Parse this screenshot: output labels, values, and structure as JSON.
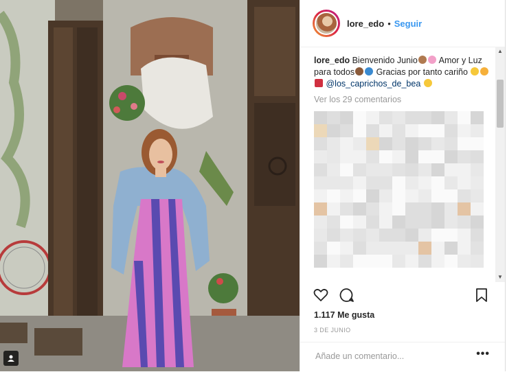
{
  "post": {
    "username": "lore_edo",
    "separator": "•",
    "follow_label": "Seguir"
  },
  "caption": {
    "username": "lore_edo",
    "part1": "Bienvenido Junio",
    "part2": "Amor y Luz para todos",
    "part3": "Gracias por tanto cariño",
    "mention": "@los_caprichos_de_bea"
  },
  "comments": {
    "view_all_label": "Ver los 29 comentarios"
  },
  "engagement": {
    "likes_label": "1.117 Me gusta",
    "date": "3 DE JUNIO"
  },
  "comment_box": {
    "placeholder": "Añade un comentario...",
    "more_label": "•••"
  },
  "colors": {
    "accent": "#3897f0",
    "mention": "#003569",
    "muted": "#999999"
  }
}
